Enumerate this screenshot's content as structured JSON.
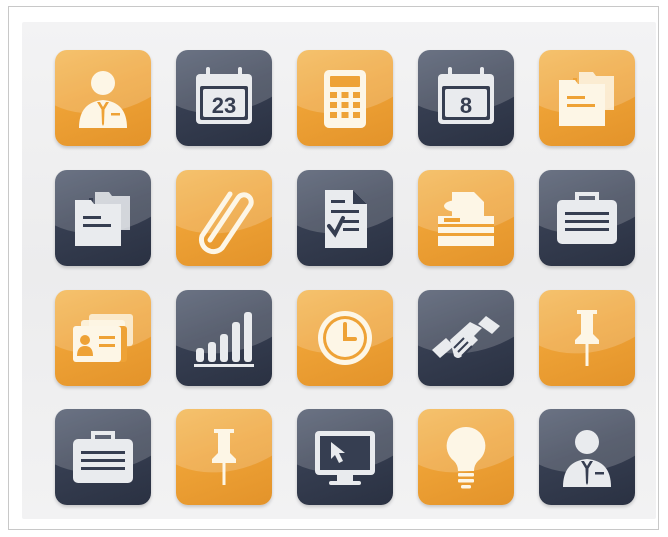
{
  "icon_grid": {
    "rows": [
      [
        {
          "icon": "businessman-icon",
          "color": "orange"
        },
        {
          "icon": "calendar-icon",
          "color": "navy",
          "text": "23"
        },
        {
          "icon": "calculator-icon",
          "color": "orange"
        },
        {
          "icon": "calendar-icon",
          "color": "navy",
          "text": "8"
        },
        {
          "icon": "folders-icon",
          "color": "orange"
        }
      ],
      [
        {
          "icon": "folders-icon",
          "color": "navy"
        },
        {
          "icon": "paperclip-icon",
          "color": "orange"
        },
        {
          "icon": "checklist-document-icon",
          "color": "navy"
        },
        {
          "icon": "fax-machine-icon",
          "color": "orange"
        },
        {
          "icon": "briefcase-icon",
          "color": "navy"
        }
      ],
      [
        {
          "icon": "business-cards-icon",
          "color": "orange"
        },
        {
          "icon": "bar-chart-icon",
          "color": "navy"
        },
        {
          "icon": "clock-icon",
          "color": "orange"
        },
        {
          "icon": "handshake-icon",
          "color": "navy"
        },
        {
          "icon": "pushpin-icon",
          "color": "orange"
        }
      ],
      [
        {
          "icon": "briefcase-icon",
          "color": "navy"
        },
        {
          "icon": "pushpin-icon",
          "color": "orange"
        },
        {
          "icon": "monitor-cursor-icon",
          "color": "navy"
        },
        {
          "icon": "light-bulb-icon",
          "color": "orange"
        },
        {
          "icon": "businessman-icon",
          "color": "navy"
        }
      ]
    ],
    "colors": {
      "orange": "#eea236",
      "navy": "#363e51",
      "glyph": "#fdf6e6"
    }
  }
}
